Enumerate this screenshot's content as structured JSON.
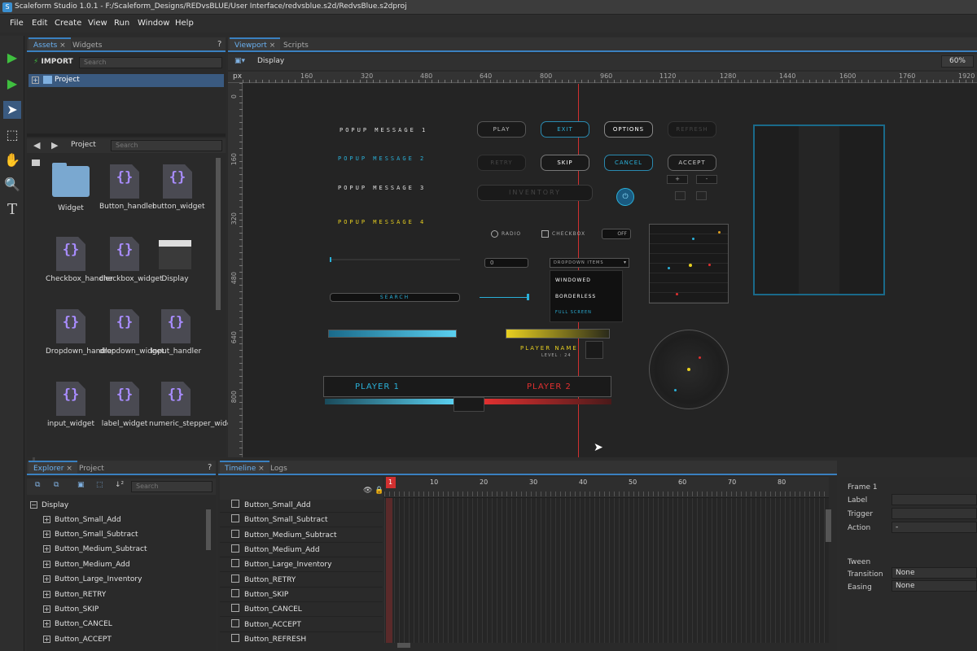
{
  "titlebar": {
    "app_icon": "S",
    "title": "Scaleform Studio 1.0.1 - F:/Scaleform_Designs/REDvsBLUE/User Interface/redvsblue.s2d/RedvsBlue.s2dproj"
  },
  "menu": [
    "File",
    "Edit",
    "Create",
    "View",
    "Run",
    "Window",
    "Help"
  ],
  "assets_panel": {
    "tabs": [
      "Assets",
      "Widgets"
    ],
    "help": "?",
    "import_label": "IMPORT",
    "search_placeholder": "Search",
    "tree_root": "Project",
    "nav_label": "Project",
    "nav_search_placeholder": "Search",
    "items": [
      "Widget",
      "Button_handler",
      "button_widget",
      "Checkbox_handler",
      "checkbox_widget",
      "Display",
      "Dropdown_handler",
      "dropdown_widget",
      "Input_handler",
      "input_widget",
      "label_widget",
      "numeric_stepper_widget"
    ],
    "icon_glyph": "{}"
  },
  "viewport": {
    "tabs": [
      "Viewport",
      "Scripts"
    ],
    "breadcrumb": "Display",
    "zoom": "60%",
    "ruler_unit": "px",
    "ruler_ticks": [
      "160",
      "320",
      "480",
      "640",
      "800",
      "960",
      "1120",
      "1280",
      "1440",
      "1600",
      "1760",
      "1920"
    ],
    "vruler_ticks": [
      "0",
      "160",
      "320",
      "480",
      "640",
      "800"
    ],
    "canvas": {
      "popups": [
        "POPUP MESSAGE 1",
        "POPUP MESSAGE 2",
        "POPUP MESSAGE 3",
        "POPUP MESSAGE 4"
      ],
      "buttons_row1": [
        "PLAY",
        "EXIT",
        "OPTIONS",
        "REFRESH"
      ],
      "buttons_row2": [
        "RETRY",
        "SKIP",
        "CANCEL",
        "ACCEPT"
      ],
      "inventory": "INVENTORY",
      "radio": "RADIO",
      "checkbox": "CHECKBOX",
      "toggle": "OFF",
      "stepper_value": "0",
      "dropdown": "DROPDOWN ITEMS",
      "dropdown_options": [
        "WINDOWED",
        "BORDERLESS",
        "FULL SCREEN"
      ],
      "search": "SEARCH",
      "player_name": "PLAYER NAME",
      "level": "LEVEL : 24",
      "player1": "PLAYER 1",
      "player2": "PLAYER 2"
    }
  },
  "explorer": {
    "tabs": [
      "Explorer",
      "Project"
    ],
    "help": "?",
    "search_placeholder": "Search",
    "root": "Display",
    "items": [
      "Button_Small_Add",
      "Button_Small_Subtract",
      "Button_Medium_Subtract",
      "Button_Medium_Add",
      "Button_Large_Inventory",
      "Button_RETRY",
      "Button_SKIP",
      "Button_CANCEL",
      "Button_ACCEPT"
    ]
  },
  "timeline": {
    "tabs": [
      "Timeline",
      "Logs"
    ],
    "frame_numbers": [
      "1",
      "10",
      "20",
      "30",
      "40",
      "50",
      "60",
      "70",
      "80"
    ],
    "rows": [
      "Button_Small_Add",
      "Button_Small_Subtract",
      "Button_Medium_Subtract",
      "Button_Medium_Add",
      "Button_Large_Inventory",
      "Button_RETRY",
      "Button_SKIP",
      "Button_CANCEL",
      "Button_ACCEPT",
      "Button_REFRESH"
    ]
  },
  "properties": {
    "frame_title": "Frame 1",
    "label": "Label",
    "trigger": "Trigger",
    "action": "Action",
    "action_value": "-",
    "tween_title": "Tween",
    "transition": "Transition",
    "transition_value": "None",
    "easing": "Easing",
    "easing_value": "None"
  },
  "colors": {
    "accent": "#3a80c0",
    "cyan": "#2ab0d8",
    "red": "#e03030",
    "yellow": "#e8d020"
  }
}
